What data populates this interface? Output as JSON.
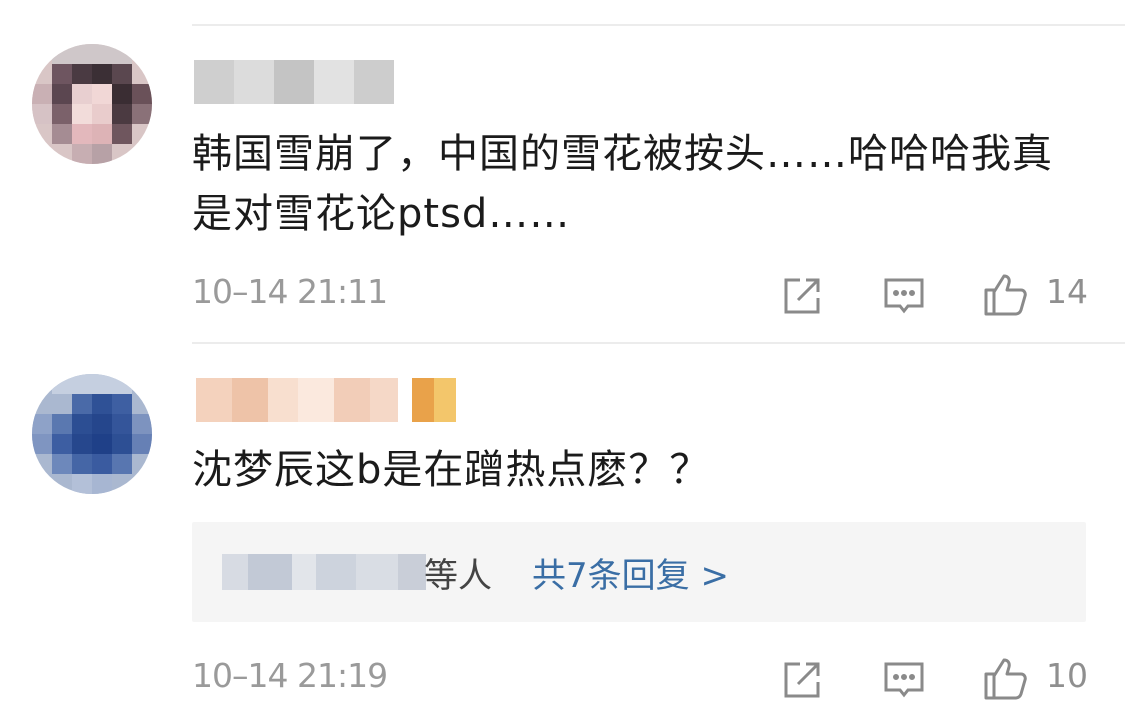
{
  "comments": [
    {
      "text": "韩国雪崩了，中国的雪花被按头……哈哈哈我真是对雪花论ptsd……",
      "timestamp": "10–14 21:11",
      "like_count": "14",
      "icons": [
        "share-icon",
        "comment-icon",
        "like-icon"
      ]
    },
    {
      "text": "沈梦辰这b是在蹭热点麽？？",
      "timestamp": "10–14 21:19",
      "like_count": "10",
      "icons": [
        "share-icon",
        "comment-icon",
        "like-icon"
      ],
      "replies": {
        "suffix": "等人",
        "link_text": "共7条回复 >"
      }
    }
  ],
  "colors": {
    "link": "#3a6ea5",
    "meta_text": "#9a9a9a",
    "reply_bg": "#f5f5f5",
    "divider": "#ececec"
  }
}
